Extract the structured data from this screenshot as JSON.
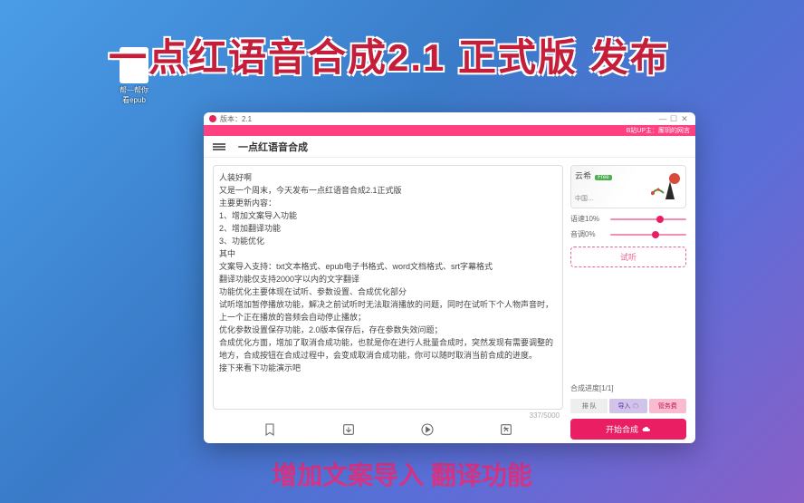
{
  "banner": "一点红语音合成2.1 正式版 发布",
  "footer": "增加文案导入 翻译功能",
  "desktop": {
    "label": "帮—帮你\n看epub"
  },
  "titlebar": {
    "version": "版本：2.1"
  },
  "pinkbar": {
    "credit": "B站UP主：厮玥的网言"
  },
  "header": {
    "title": "一点红语音合成"
  },
  "textarea": "人装好啊\n又是一个周末，今天发布一点红语音合成2.1正式版\n主要更新内容：\n1、增加文案导入功能\n2、增加翻译功能\n3、功能优化\n其中\n文案导入支持：txt文本格式、epub电子书格式、word文档格式、srt字幕格式\n翻译功能仅支持2000字以内的文字翻译\n功能优化主要体现在试听、参数设置、合成优化部分\n试听增加暂停播放功能，解决之前试听时无法取消播放的问题，同时在试听下个人物声音时，上一个正在播放的音频会自动停止播放；\n优化参数设置保存功能，2.0版本保存后，存在参数失效问题；\n合成优化方面，增加了取消合成功能，也就是你在进行人批量合成时，突然发现有需要调整的地方，合成按钮在合成过程中，会变成取消合成功能，你可以随时取消当前合成的进度。\n接下来看下功能演示吧",
  "counter": "337/5000",
  "voice": {
    "name": "云希",
    "free": "Free",
    "sub": "中国…"
  },
  "sliders": {
    "speed": {
      "label": "语速10%",
      "pos": 65
    },
    "pitch": {
      "label": "音调0%",
      "pos": 60
    }
  },
  "listen": "试听",
  "progress": "合成进度[1/1]",
  "tabs": [
    "排 队",
    "导入 ☁",
    "管务费"
  ],
  "start": "开始合成"
}
